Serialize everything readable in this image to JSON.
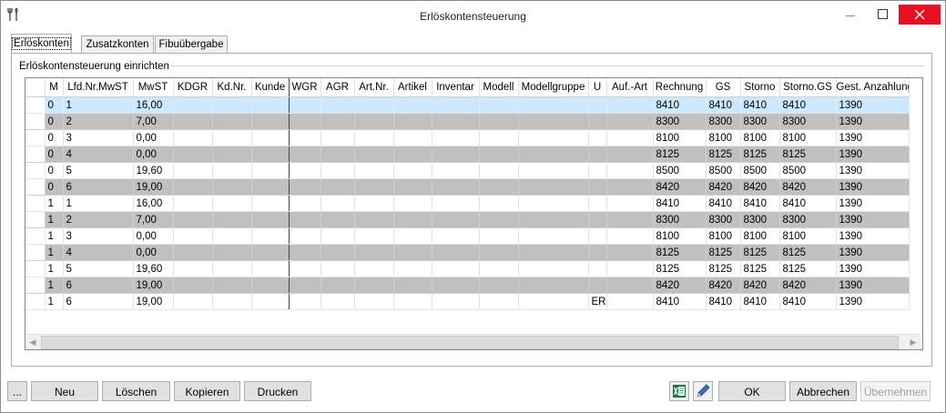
{
  "window": {
    "title": "Erlöskontensteuerung"
  },
  "tabs": [
    {
      "label": "Erlöskonten",
      "active": true
    },
    {
      "label": "Zusatzkonten",
      "active": false
    },
    {
      "label": "Fibuübergabe",
      "active": false
    }
  ],
  "group": {
    "label": "Erlöskontensteuerung einrichten"
  },
  "table": {
    "columns": [
      "M",
      "Lfd.Nr.MwST",
      "MwST",
      "KDGR",
      "Kd.Nr.",
      "Kunde",
      "WGR",
      "AGR",
      "Art.Nr.",
      "Artikel",
      "Inventar",
      "Modell",
      "Modellgruppe",
      "U",
      "Auf.-Art",
      "Rechnung",
      "GS",
      "Storno",
      "Storno.GS",
      "Gest. Anzahlung"
    ],
    "rows": [
      [
        "0",
        "1",
        "16,00",
        "",
        "",
        "",
        "",
        "",
        "",
        "",
        "",
        "",
        "",
        "",
        "",
        "8410",
        "8410",
        "8410",
        "8410",
        "1390"
      ],
      [
        "0",
        "2",
        "7,00",
        "",
        "",
        "",
        "",
        "",
        "",
        "",
        "",
        "",
        "",
        "",
        "",
        "8300",
        "8300",
        "8300",
        "8300",
        "1390"
      ],
      [
        "0",
        "3",
        "0,00",
        "",
        "",
        "",
        "",
        "",
        "",
        "",
        "",
        "",
        "",
        "",
        "",
        "8100",
        "8100",
        "8100",
        "8100",
        "1390"
      ],
      [
        "0",
        "4",
        "0,00",
        "",
        "",
        "",
        "",
        "",
        "",
        "",
        "",
        "",
        "",
        "",
        "",
        "8125",
        "8125",
        "8125",
        "8125",
        "1390"
      ],
      [
        "0",
        "5",
        "19,60",
        "",
        "",
        "",
        "",
        "",
        "",
        "",
        "",
        "",
        "",
        "",
        "",
        "8500",
        "8500",
        "8500",
        "8500",
        "1390"
      ],
      [
        "0",
        "6",
        "19,00",
        "",
        "",
        "",
        "",
        "",
        "",
        "",
        "",
        "",
        "",
        "",
        "",
        "8420",
        "8420",
        "8420",
        "8420",
        "1390"
      ],
      [
        "1",
        "1",
        "16,00",
        "",
        "",
        "",
        "",
        "",
        "",
        "",
        "",
        "",
        "",
        "",
        "",
        "8410",
        "8410",
        "8410",
        "8410",
        "1390"
      ],
      [
        "1",
        "2",
        "7,00",
        "",
        "",
        "",
        "",
        "",
        "",
        "",
        "",
        "",
        "",
        "",
        "",
        "8300",
        "8300",
        "8300",
        "8300",
        "1390"
      ],
      [
        "1",
        "3",
        "0,00",
        "",
        "",
        "",
        "",
        "",
        "",
        "",
        "",
        "",
        "",
        "",
        "",
        "8100",
        "8100",
        "8100",
        "8100",
        "1390"
      ],
      [
        "1",
        "4",
        "0,00",
        "",
        "",
        "",
        "",
        "",
        "",
        "",
        "",
        "",
        "",
        "",
        "",
        "8125",
        "8125",
        "8125",
        "8125",
        "1390"
      ],
      [
        "1",
        "5",
        "19,60",
        "",
        "",
        "",
        "",
        "",
        "",
        "",
        "",
        "",
        "",
        "",
        "",
        "8125",
        "8125",
        "8125",
        "8125",
        "1390"
      ],
      [
        "1",
        "6",
        "19,00",
        "",
        "",
        "",
        "",
        "",
        "",
        "",
        "",
        "",
        "",
        "",
        "",
        "8420",
        "8420",
        "8420",
        "8420",
        "1390"
      ],
      [
        "1",
        "6",
        "19,00",
        "",
        "",
        "",
        "",
        "",
        "",
        "",
        "",
        "",
        "",
        "ERL",
        "",
        "8410",
        "8410",
        "8410",
        "8410",
        "1390"
      ]
    ]
  },
  "buttons": {
    "more": "...",
    "new": "Neu",
    "delete": "Löschen",
    "copy": "Kopieren",
    "print": "Drucken",
    "ok": "OK",
    "cancel": "Abbrechen",
    "apply": "Übernehmen"
  },
  "icons": {
    "excel": "excel-icon",
    "edit": "pencil-icon",
    "app": "tools-icon"
  },
  "colors": {
    "selected_row": "#cce8ff",
    "gray_row": "#c0c0c0",
    "close_button": "#e81123"
  }
}
